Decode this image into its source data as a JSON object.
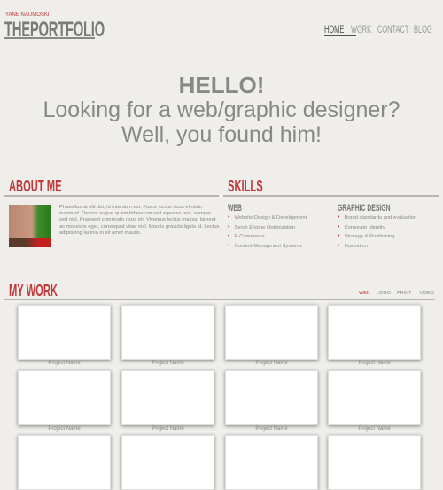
{
  "header": {
    "tagline": "YANE NAUMOSKI",
    "logo": "THEPORTFOLIO",
    "nav": [
      "HOME",
      "WORK",
      "CONTACT",
      "BLOG"
    ]
  },
  "hero": {
    "title": "HELLO!",
    "line1": "Looking for a web/graphic designer?",
    "line2": "Well, you found him!"
  },
  "about": {
    "title": "ABOUT ME",
    "text": "Phasellus at elit dui, id interdum est. Fusce luctus risus et oldio euismod. Democ augue quam,bibendum sed egestas non, semper sed nisl. Praesent commodo risus mi. Vivamus lectus massa, laoreet ac mokestis eget, consequat vitae nisl. Mauris gravida ligula id. Lectus adipiscing lacinia in sit amet mauris."
  },
  "skills": {
    "title": "SKILLS",
    "web": {
      "title": "WEB",
      "items": [
        "Website Desigh & Development",
        "Serch Engine Optimization",
        "E-Commerce",
        "Content Managment Systems"
      ]
    },
    "graphic": {
      "title": "GRAPHIC DESIGN",
      "items": [
        "Brand standards and evaluation",
        "Corporate Identity",
        "Strategy & Positioning",
        "Illustration"
      ]
    }
  },
  "work": {
    "title": "MY WORK",
    "filters": [
      "WEB",
      "LOGO",
      "PRINT",
      "VIDEO"
    ],
    "project_label": "Project Name"
  },
  "colors": {
    "accent": "#c0393b",
    "background": "#efeeea"
  }
}
